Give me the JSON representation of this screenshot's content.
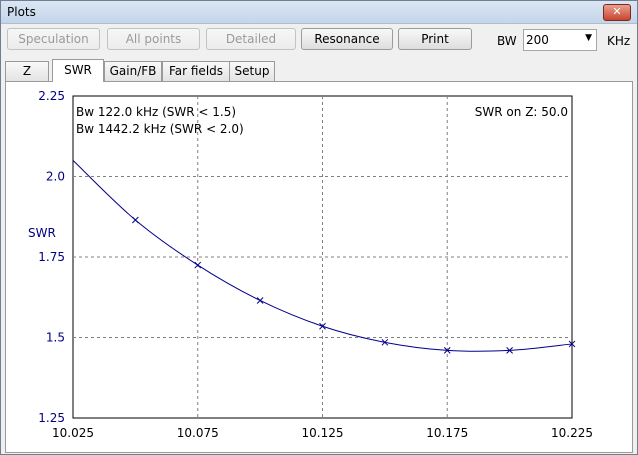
{
  "window": {
    "title": "Plots",
    "close_label": "✕"
  },
  "toolbar": {
    "buttons": [
      {
        "label": "Speculation",
        "enabled": false
      },
      {
        "label": "All points",
        "enabled": false
      },
      {
        "label": "Detailed",
        "enabled": false
      },
      {
        "label": "Resonance",
        "enabled": true
      },
      {
        "label": "Print",
        "enabled": true
      }
    ],
    "bw_label": "BW",
    "bw_value": "200",
    "bw_unit": "KHz"
  },
  "tabs": [
    {
      "label": "Z",
      "active": false
    },
    {
      "label": "SWR",
      "active": true
    },
    {
      "label": "Gain/FB",
      "active": false
    },
    {
      "label": "Far fields",
      "active": false
    },
    {
      "label": "Setup",
      "active": false
    }
  ],
  "chart_data": {
    "type": "line",
    "ylabel": "SWR",
    "xlim": [
      10.025,
      10.225
    ],
    "ylim": [
      1.25,
      2.25
    ],
    "x_ticks": [
      "10.025",
      "10.075",
      "10.125",
      "10.175",
      "10.225"
    ],
    "y_ticks": [
      "1.25",
      "1.5",
      "1.75",
      "2.0",
      "2.25"
    ],
    "grid": true,
    "line_color": "#00008b",
    "annotations": [
      "Bw 122.0 kHz (SWR < 1.5)",
      "Bw 1442.2 kHz (SWR < 2.0)"
    ],
    "annotation_right": "SWR on Z: 50.0",
    "x": [
      10.025,
      10.05,
      10.075,
      10.1,
      10.125,
      10.15,
      10.175,
      10.2,
      10.225
    ],
    "y": [
      2.05,
      1.865,
      1.725,
      1.615,
      1.535,
      1.485,
      1.46,
      1.46,
      1.48
    ]
  }
}
